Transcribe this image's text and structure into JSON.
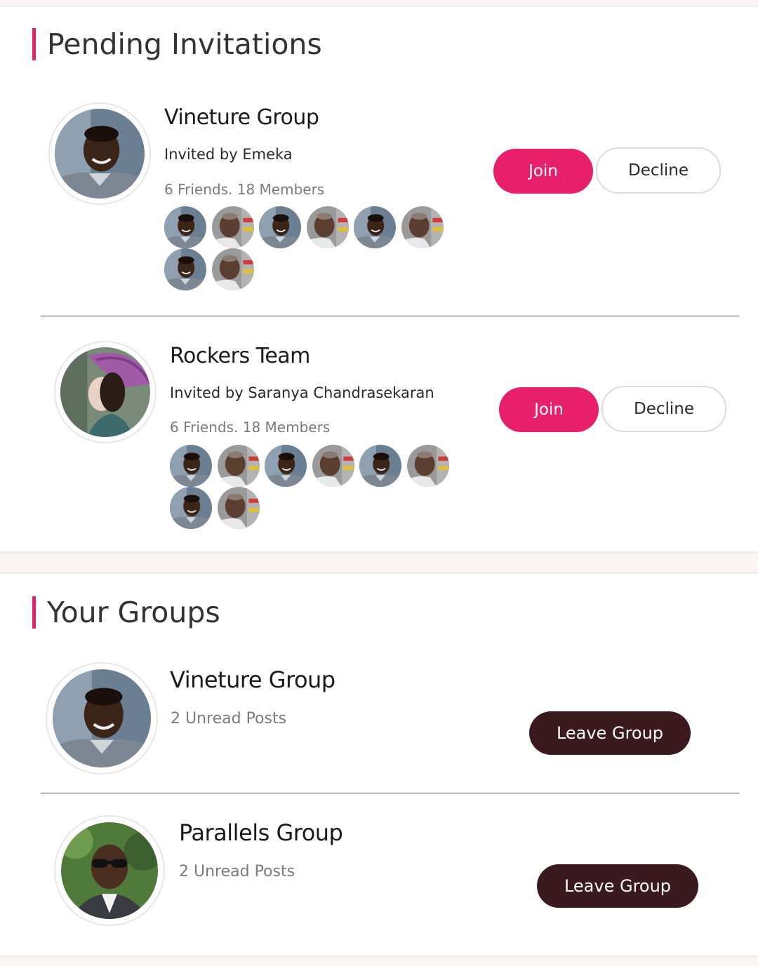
{
  "pending_invitations": {
    "title": "Pending Invitations",
    "items": [
      {
        "name": "Vineture Group",
        "invited_by": "Invited by Emeka",
        "meta": "6 Friends. 18 Members",
        "avatar": "man-portrait",
        "members": [
          "man-portrait",
          "elder-portrait",
          "man-portrait",
          "elder-portrait",
          "man-portrait",
          "elder-portrait",
          "man-portrait",
          "elder-portrait"
        ],
        "join_label": "Join",
        "decline_label": "Decline"
      },
      {
        "name": "Rockers Team",
        "invited_by": "Invited by Saranya Chandrasekaran",
        "meta": "6 Friends. 18 Members",
        "avatar": "woman-umbrella-portrait",
        "members": [
          "man-portrait",
          "elder-portrait",
          "man-portrait",
          "elder-portrait",
          "man-portrait",
          "elder-portrait",
          "man-portrait",
          "elder-portrait"
        ],
        "join_label": "Join",
        "decline_label": "Decline"
      }
    ]
  },
  "your_groups": {
    "title": "Your Groups",
    "items": [
      {
        "name": "Vineture Group",
        "unread": "2 Unread Posts",
        "avatar": "man-portrait",
        "leave_label": "Leave Group"
      },
      {
        "name": "Parallels Group",
        "unread": "2 Unread Posts",
        "avatar": "man-sunglasses-portrait",
        "leave_label": "Leave Group"
      }
    ]
  },
  "colors": {
    "accent": "#e8206b",
    "leave_button": "#3a1a1f",
    "background": "#fbf4f5"
  }
}
